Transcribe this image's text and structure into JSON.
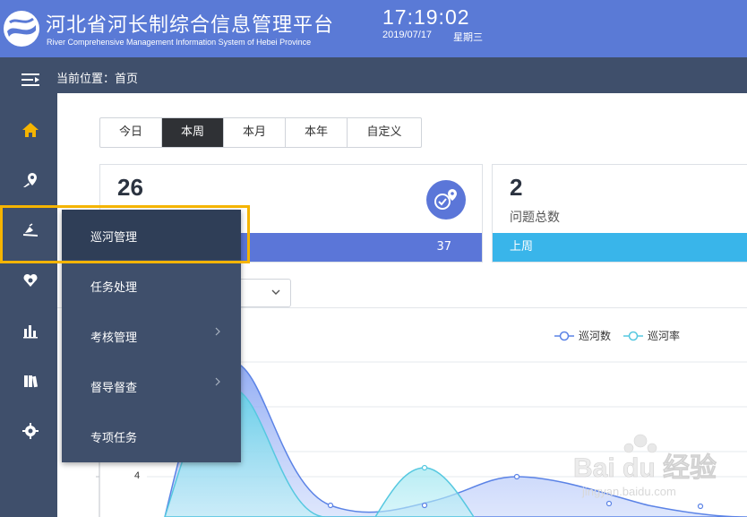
{
  "header": {
    "title_cn": "河北省河长制综合信息管理平台",
    "title_en": "River Comprehensive Management Information  System of Hebei Province",
    "time": "17:19:02",
    "date": "2019/07/17",
    "weekday": "星期三",
    "logo_icon": "river-swirl-logo-icon"
  },
  "breadcrumb": {
    "text": "当前位置：首页"
  },
  "sidebar": {
    "items": [
      {
        "icon": "home-icon"
      },
      {
        "icon": "map-pin-icon"
      },
      {
        "icon": "patrol-river-icon",
        "active": true
      },
      {
        "icon": "heart-shield-icon"
      },
      {
        "icon": "bar-chart-icon"
      },
      {
        "icon": "books-icon"
      },
      {
        "icon": "gear-icon"
      }
    ]
  },
  "tabs": [
    {
      "label": "今日",
      "active": false
    },
    {
      "label": "本周",
      "active": true
    },
    {
      "label": "本月",
      "active": false
    },
    {
      "label": "本年",
      "active": false
    },
    {
      "label": "自定义",
      "active": false
    }
  ],
  "cards": [
    {
      "value": "26",
      "label": "",
      "footer_left": "",
      "footer_right": "37",
      "icon": "patrol-location-icon",
      "footer_color": "#5b76d8"
    },
    {
      "value": "2",
      "label": "问题总数",
      "footer_left": "上周",
      "footer_right": "",
      "footer_color": "#39b5ea"
    }
  ],
  "submenu": {
    "items": [
      {
        "label": "巡河管理",
        "active": true,
        "has_children": false
      },
      {
        "label": "任务处理",
        "active": false,
        "has_children": false
      },
      {
        "label": "考核管理",
        "active": false,
        "has_children": true
      },
      {
        "label": "督导督查",
        "active": false,
        "has_children": true
      },
      {
        "label": "专项任务",
        "active": false,
        "has_children": false
      }
    ]
  },
  "chart_data": {
    "type": "area",
    "series": [
      {
        "name": "巡河数",
        "color": "#5b83e6"
      },
      {
        "name": "巡河率",
        "color": "#56c8e0"
      }
    ],
    "y_tick_visible": "4",
    "grid": true
  },
  "watermark": {
    "text": "Bai du 经验",
    "subtext": "jingyan.baidu.com"
  },
  "colors": {
    "header": "#5a7ad6",
    "sidebar": "#3f4f6b",
    "highlight": "#f5b400"
  }
}
